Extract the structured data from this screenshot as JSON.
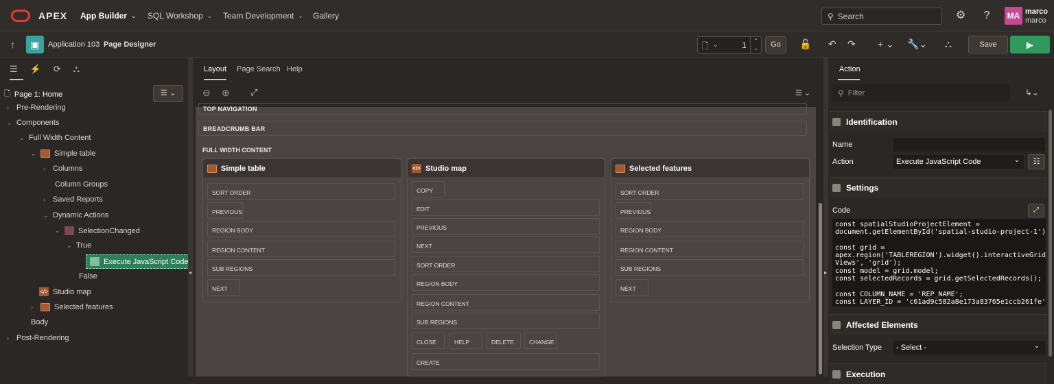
{
  "header": {
    "brand": "APEX",
    "nav": [
      {
        "label": "App Builder"
      },
      {
        "label": "SQL Workshop"
      },
      {
        "label": "Team Development"
      },
      {
        "label": "Gallery"
      }
    ],
    "search_placeholder": "Search",
    "user": {
      "initials": "MA",
      "name": "marco",
      "subtitle": "marco"
    }
  },
  "toolbar": {
    "app": "Application 103",
    "page": "Page Designer",
    "page_number": "1",
    "go_label": "Go",
    "save_label": "Save"
  },
  "left": {
    "page_title": "Page 1: Home",
    "tree": {
      "pre_rendering": "Pre-Rendering",
      "components": "Components",
      "full_width": "Full Width Content",
      "simple_table": "Simple table",
      "columns": "Columns",
      "column_groups": "Column Groups",
      "saved_reports": "Saved Reports",
      "dynamic_actions": "Dynamic Actions",
      "selection_changed": "SelectionChanged",
      "true_label": "True",
      "execute_js": "Execute JavaScript Code",
      "false_label": "False",
      "studio_map": "Studio map",
      "selected_features": "Selected features",
      "body": "Body",
      "post_rendering": "Post-Rendering"
    }
  },
  "center": {
    "tabs": [
      "Layout",
      "Page Search",
      "Help"
    ],
    "slots": {
      "top_nav": "TOP NAVIGATION",
      "breadcrumb": "BREADCRUMB BAR",
      "full_width": "FULL WIDTH CONTENT"
    },
    "regions": {
      "simple_table": {
        "title": "Simple table",
        "positions": [
          "SORT ORDER",
          "PREVIOUS",
          "REGION BODY",
          "REGION CONTENT",
          "SUB REGIONS",
          "NEXT"
        ]
      },
      "studio_map": {
        "title": "Studio map",
        "positions": [
          "COPY",
          "EDIT",
          "PREVIOUS",
          "NEXT",
          "SORT ORDER",
          "REGION BODY",
          "REGION CONTENT",
          "SUB REGIONS"
        ],
        "row": [
          "CLOSE",
          "HELP",
          "DELETE",
          "CHANGE"
        ],
        "last": "CREATE"
      },
      "selected_features": {
        "title": "Selected features",
        "positions": [
          "SORT ORDER",
          "PREVIOUS",
          "REGION BODY",
          "REGION CONTENT",
          "SUB REGIONS",
          "NEXT"
        ]
      }
    }
  },
  "right": {
    "tab": "Action",
    "filter_placeholder": "Filter",
    "identification": "Identification",
    "name_label": "Name",
    "name_value": "",
    "action_label": "Action",
    "action_value": "Execute JavaScript Code",
    "settings": "Settings",
    "code_label": "Code",
    "code": "const spatialStudioProjectElement =\ndocument.getElementById('spatial-studio-project-1');\n\nconst grid =\napex.region('TABLEREGION').widget().interactiveGrid('get\nViews', 'grid');\nconst model = grid.model;\nconst selectedRecords = grid.getSelectedRecords();\n\nconst COLUMN_NAME = 'REP_NAME';\nconst LAYER_ID = 'c61ad9c582a8e173a83765e1ccb261fe';",
    "affected": "Affected Elements",
    "selection_type_label": "Selection Type",
    "selection_type_value": "- Select -",
    "execution": "Execution"
  }
}
